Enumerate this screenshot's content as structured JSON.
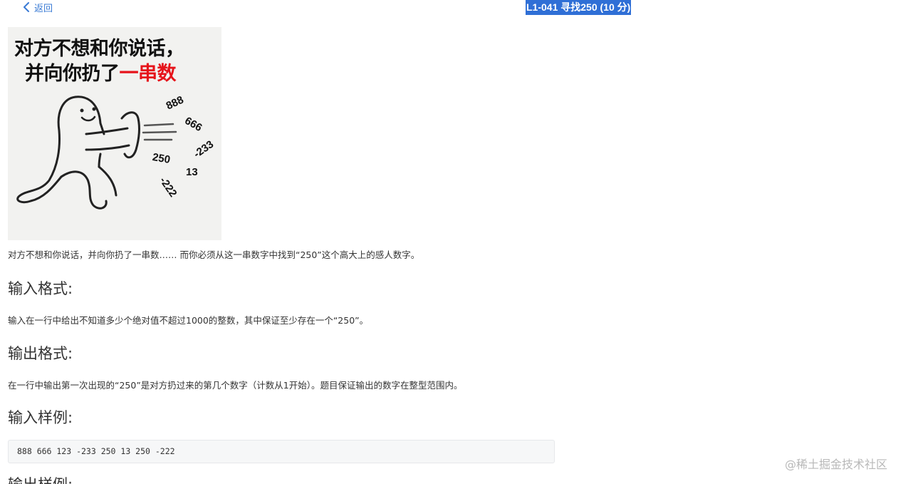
{
  "nav": {
    "back_label": "返回"
  },
  "problem": {
    "title": "L1-041 寻找250 (10 分)"
  },
  "meme": {
    "line1": "对方不想和你说话，",
    "line2_prefix": "并向你扔了",
    "line2_highlight": "一串数",
    "numbers": [
      "888",
      "666",
      "-233",
      "250",
      "13",
      "-222"
    ],
    "highlight_color": "#e6141b"
  },
  "content": {
    "description": "对方不想和你说话，并向你扔了一串数…… 而你必须从这一串数字中找到“250”这个高大上的感人数字。",
    "input_format_heading": "输入格式:",
    "input_format_text": "输入在一行中给出不知道多少个绝对值不超过1000的整数，其中保证至少存在一个“250”。",
    "output_format_heading": "输出格式:",
    "output_format_text": "在一行中输出第一次出现的“250”是对方扔过来的第几个数字（计数从1开始）。题目保证输出的数字在整型范围内。",
    "sample_input_heading": "输入样例:",
    "sample_input_code": "888 666 123 -233 250 13 250 -222",
    "sample_output_heading": "输出样例:"
  },
  "watermark": "@稀土掘金技术社区",
  "colors": {
    "link": "#3a7bd5",
    "title_highlight": "#2f6fd6"
  }
}
